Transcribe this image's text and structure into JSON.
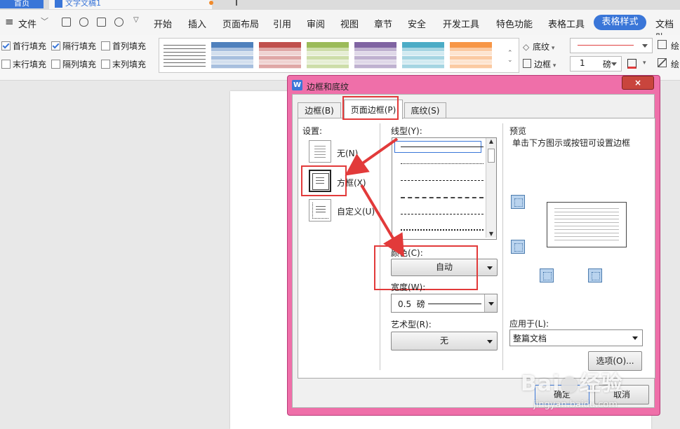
{
  "tabs": {
    "home": "首页",
    "doc": "文字文稿1",
    "plus": "+"
  },
  "menu": {
    "file": "文件",
    "items": [
      "开始",
      "插入",
      "页面布局",
      "引用",
      "审阅",
      "视图",
      "章节",
      "安全",
      "开发工具",
      "特色功能",
      "表格工具",
      "表格样式",
      "文档助"
    ]
  },
  "ribbon": {
    "checkboxes": [
      {
        "label": "首行填充",
        "checked": true
      },
      {
        "label": "隔行填充",
        "checked": true
      },
      {
        "label": "首列填充",
        "checked": false
      },
      {
        "label": "末行填充",
        "checked": false
      },
      {
        "label": "隔列填充",
        "checked": false
      },
      {
        "label": "末列填充",
        "checked": false
      }
    ],
    "shading_label": "底纹",
    "border_label": "边框",
    "line_weight_value": "1",
    "line_weight_unit": "磅",
    "draw_label": "绘",
    "style_colors": [
      "#444444",
      "#4f81bd",
      "#c0504d",
      "#9bbb59",
      "#8064a2",
      "#4bacc6",
      "#f79646"
    ]
  },
  "dialog": {
    "title": "边框和底纹",
    "close": "×",
    "tabs": [
      "边框(B)",
      "页面边框(P)",
      "底纹(S)"
    ],
    "settings_label": "设置:",
    "settings": [
      "无(N)",
      "方框(X)",
      "自定义(U)"
    ],
    "line_style_label": "线型(Y):",
    "color_label": "颜色(C):",
    "color_value": "自动",
    "width_label": "宽度(W):",
    "width_value": "0.5  磅",
    "art_label": "艺术型(R):",
    "art_value": "无",
    "preview_label": "预览",
    "preview_hint": "单击下方图示或按钮可设置边框",
    "apply_label": "应用于(L):",
    "apply_value": "整篇文档",
    "options_button": "选项(O)...",
    "ok_button": "确定",
    "cancel_button": "取消"
  },
  "watermark": {
    "brand": "Bai",
    "brand2": "经验",
    "url": "jingyan.baidu.com"
  },
  "colors": {
    "accent": "#3a76d8",
    "dialog_frame": "#ef6fa9",
    "annotation": "#e23a3a"
  }
}
